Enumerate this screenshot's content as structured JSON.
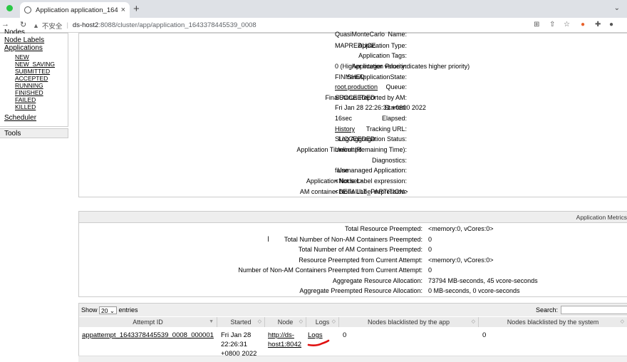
{
  "browser": {
    "tab_title": "Application application_16433",
    "tab_close": "×",
    "new_tab": "+",
    "insecure_label": "不安全",
    "url_host": "ds-host2",
    "url_path": ":8088/cluster/app/application_1643378445539_0008"
  },
  "leftnav": {
    "top_fragment": "Nodes",
    "node_labels": "Node Labels",
    "applications": "Applications",
    "states": [
      "NEW",
      "NEW_SAVING",
      "SUBMITTED",
      "ACCEPTED",
      "RUNNING",
      "FINISHED",
      "FAILED",
      "KILLED"
    ],
    "scheduler": "Scheduler",
    "tools": "Tools"
  },
  "overview": {
    "rows": [
      {
        "key": "Name:",
        "value": "QuasiMonteCarlo",
        "link": false
      },
      {
        "key": "Application Type:",
        "value": "MAPREDUCE",
        "link": false
      },
      {
        "key": "Application Tags:",
        "value": "",
        "link": false
      },
      {
        "key": "Application Priority:",
        "value": "0 (Higher integer value indicates higher priority)",
        "link": false
      },
      {
        "key": "YarnApplicationState:",
        "value": "FINISHED",
        "link": false
      },
      {
        "key": "Queue:",
        "value": "root.production",
        "link": true
      },
      {
        "key": "FinalStatus Reported by AM:",
        "value": "SUCCEEDED",
        "link": false
      },
      {
        "key": "Started:",
        "value": "Fri Jan 28 22:26:31 +0800 2022",
        "link": false
      },
      {
        "key": "Elapsed:",
        "value": "16sec",
        "link": false
      },
      {
        "key": "Tracking URL:",
        "value": "History",
        "link": true
      },
      {
        "key": "Log Aggregation Status:",
        "value": "SUCCEEDED",
        "link": false
      },
      {
        "key": "Application Timeout (Remaining Time):",
        "value": "Unlimited",
        "link": false
      },
      {
        "key": "Diagnostics:",
        "value": "",
        "link": false
      },
      {
        "key": "Unmanaged Application:",
        "value": "false",
        "link": false
      },
      {
        "key": "Application Node Label expression:",
        "value": "<Not set>",
        "link": false
      },
      {
        "key": "AM container Node Label expression:",
        "value": "<DEFAULT_PARTITION>",
        "link": false
      }
    ]
  },
  "metrics": {
    "header": "Application Metrics",
    "rows": [
      {
        "key": "Total Resource Preempted:",
        "value": "<memory:0, vCores:0>"
      },
      {
        "key": "Total Number of Non-AM Containers Preempted:",
        "value": "0"
      },
      {
        "key": "Total Number of AM Containers Preempted:",
        "value": "0"
      },
      {
        "key": "Resource Preempted from Current Attempt:",
        "value": "<memory:0, vCores:0>"
      },
      {
        "key": "Number of Non-AM Containers Preempted from Current Attempt:",
        "value": "0"
      },
      {
        "key": "Aggregate Resource Allocation:",
        "value": "73794 MB-seconds, 45 vcore-seconds"
      },
      {
        "key": "Aggregate Preempted Resource Allocation:",
        "value": "0 MB-seconds, 0 vcore-seconds"
      }
    ]
  },
  "attempts": {
    "show_label": "Show",
    "entries_value": "20",
    "entries_label": "entries",
    "search_label": "Search:",
    "columns": [
      "Attempt ID",
      "Started",
      "Node",
      "Logs",
      "Nodes blacklisted by the app",
      "Nodes blacklisted by the system"
    ],
    "row": {
      "attempt_id": "appattempt_1643378445539_0008_000001",
      "started_lines": [
        "Fri Jan 28",
        "22:26:31",
        "+0800 2022"
      ],
      "node_lines": [
        "http://ds-",
        "host1:8042"
      ],
      "logs": "Logs",
      "blacklisted_app": "0",
      "blacklisted_system": "0"
    }
  },
  "colors": {
    "annotation": "#e01010"
  }
}
